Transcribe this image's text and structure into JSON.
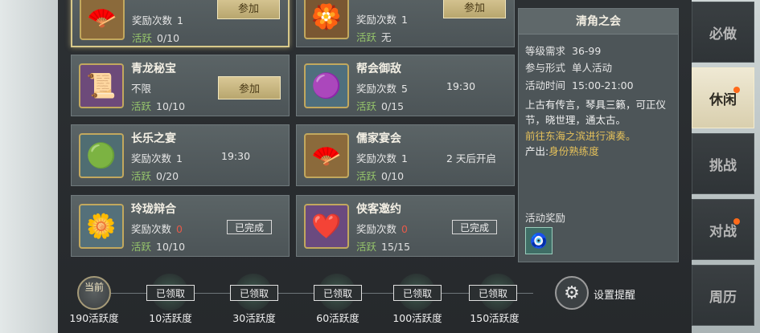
{
  "activities": [
    {
      "id": "a1",
      "name": "",
      "reward_label": "奖励次数",
      "reward_count": "1",
      "active_label": "活跃",
      "active_value": "0/10",
      "action": "参加",
      "icon": "fan-icon"
    },
    {
      "id": "a2",
      "name": "",
      "reward_label": "奖励次数",
      "reward_count": "1",
      "active_label": "活跃",
      "active_value": "无",
      "action": "参加",
      "icon": "portrait-icon"
    },
    {
      "id": "a3",
      "name": "青龙秘宝",
      "reward_label": "不限",
      "active_label": "活跃",
      "active_value": "10/10",
      "action": "参加",
      "icon": "scroll-icon"
    },
    {
      "id": "a4",
      "name": "帮会御敌",
      "reward_label": "奖励次数",
      "reward_count": "5",
      "time": "19:30",
      "active_label": "活跃",
      "active_value": "0/15",
      "icon": "spirit-icon"
    },
    {
      "id": "a5",
      "name": "长乐之宴",
      "reward_label": "奖励次数",
      "reward_count": "1",
      "time": "19:30",
      "active_label": "活跃",
      "active_value": "0/20",
      "icon": "jade-icon"
    },
    {
      "id": "a6",
      "name": "儒家宴会",
      "reward_label": "奖励次数",
      "reward_count": "1",
      "time": "2 天后开启",
      "active_label": "活跃",
      "active_value": "0/10",
      "icon": "fan-icon"
    },
    {
      "id": "a7",
      "name": "玲珑辩合",
      "reward_label": "奖励次数",
      "reward_count": "0",
      "status": "已完成",
      "active_label": "活跃",
      "active_value": "10/10",
      "icon": "flower-icon"
    },
    {
      "id": "a8",
      "name": "侠客邀约",
      "reward_label": "奖励次数",
      "reward_count": "0",
      "status": "已完成",
      "active_label": "活跃",
      "active_value": "15/15",
      "icon": "heart-icon"
    }
  ],
  "detail": {
    "title": "清角之会",
    "level_label": "等级需求",
    "level_value": "36-99",
    "form_label": "参与形式",
    "form_value": "单人活动",
    "time_label": "活动时间",
    "time_value": "15:00-21:00",
    "description": "上古有传言，琴具三籁，可正仪节，晓世理，通太古。",
    "hint": "前往东海之滨进行演奏。",
    "output_label": "产出:",
    "output_value": "身份熟练度",
    "reward_label": "活动奖励"
  },
  "side_tabs": [
    {
      "label": "必做",
      "active": false
    },
    {
      "label": "休闲",
      "active": true
    },
    {
      "label": "挑战",
      "active": false
    },
    {
      "label": "对战",
      "active": false
    },
    {
      "label": "周历",
      "active": false
    }
  ],
  "progress": {
    "current_label": "当前",
    "current_value": "190活跃度",
    "milestones": [
      {
        "status": "已领取",
        "label": "10活跃度"
      },
      {
        "status": "已领取",
        "label": "30活跃度"
      },
      {
        "status": "已领取",
        "label": "60活跃度"
      },
      {
        "status": "已领取",
        "label": "100活跃度"
      },
      {
        "status": "已领取",
        "label": "150活跃度"
      }
    ]
  },
  "settings": {
    "label": "设置提醒",
    "icon": "gear-icon"
  },
  "colors": {
    "accent_gold": "#d9c896",
    "active_green": "#95c46b",
    "zero_red": "#e55a4a",
    "hint_gold": "#e4c05a",
    "notify_orange": "#ff6a1a"
  }
}
